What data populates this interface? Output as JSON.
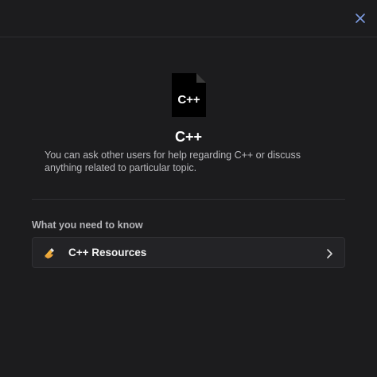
{
  "channel": {
    "icon": "cpp-file-icon",
    "icon_text": "C++",
    "title": "C++",
    "description": "You can ask other users for help regarding C++ or discuss anything related to particular topic."
  },
  "section": {
    "label": "What you need to know"
  },
  "resources": [
    {
      "icon": "writing-hand-icon",
      "label": "C++ Resources"
    }
  ],
  "colors": {
    "background": "#1c1c1e",
    "card": "#232326",
    "accent_close": "#6f8fd8"
  }
}
